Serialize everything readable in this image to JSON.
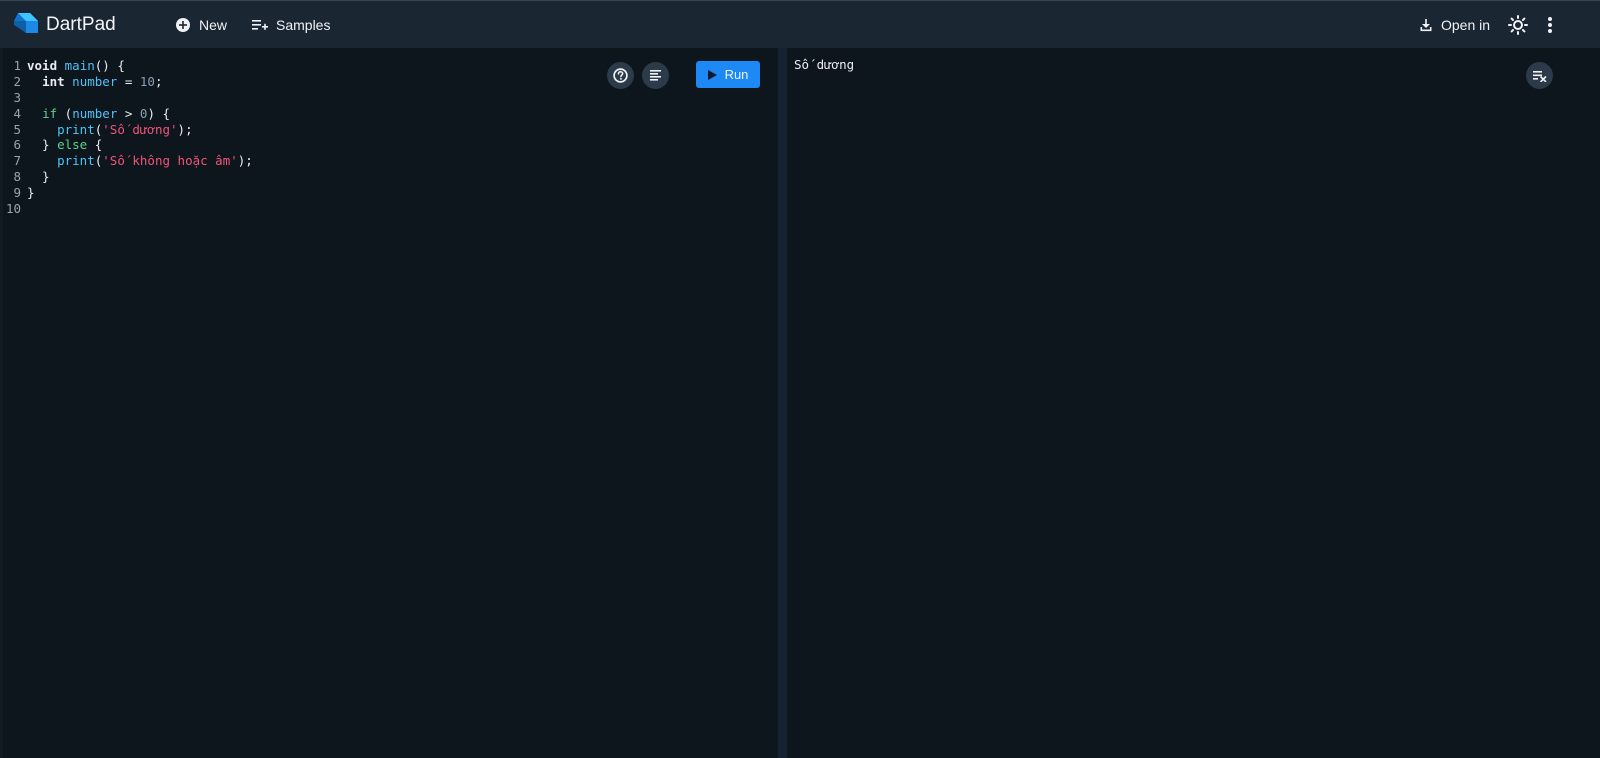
{
  "app": {
    "title": "DartPad"
  },
  "toolbar": {
    "new_label": "New",
    "samples_label": "Samples",
    "open_in_label": "Open in"
  },
  "editor": {
    "run_label": "Run",
    "lines": [
      {
        "n": "1",
        "tokens": [
          [
            "kw",
            "void"
          ],
          [
            "pun",
            " "
          ],
          [
            "fn",
            "main"
          ],
          [
            "pun",
            "() {"
          ]
        ]
      },
      {
        "n": "2",
        "tokens": [
          [
            "pun",
            "  "
          ],
          [
            "kw",
            "int"
          ],
          [
            "pun",
            " "
          ],
          [
            "var",
            "number"
          ],
          [
            "pun",
            " = "
          ],
          [
            "num",
            "10"
          ],
          [
            "pun",
            ";"
          ]
        ]
      },
      {
        "n": "3",
        "tokens": []
      },
      {
        "n": "4",
        "tokens": [
          [
            "pun",
            "  "
          ],
          [
            "ctl",
            "if"
          ],
          [
            "pun",
            " ("
          ],
          [
            "var",
            "number"
          ],
          [
            "pun",
            " > "
          ],
          [
            "num",
            "0"
          ],
          [
            "pun",
            ") {"
          ]
        ]
      },
      {
        "n": "5",
        "tokens": [
          [
            "pun",
            "    "
          ],
          [
            "fn",
            "print"
          ],
          [
            "pun",
            "("
          ],
          [
            "str",
            "'Số dương'"
          ],
          [
            "pun",
            ");"
          ]
        ]
      },
      {
        "n": "6",
        "tokens": [
          [
            "pun",
            "  } "
          ],
          [
            "ctl",
            "else"
          ],
          [
            "pun",
            " {"
          ]
        ]
      },
      {
        "n": "7",
        "tokens": [
          [
            "pun",
            "    "
          ],
          [
            "fn",
            "print"
          ],
          [
            "pun",
            "("
          ],
          [
            "str",
            "'Số không hoặc âm'"
          ],
          [
            "pun",
            ");"
          ]
        ]
      },
      {
        "n": "8",
        "tokens": [
          [
            "pun",
            "  }"
          ]
        ]
      },
      {
        "n": "9",
        "tokens": [
          [
            "pun",
            "}"
          ]
        ]
      },
      {
        "n": "10",
        "tokens": []
      }
    ]
  },
  "output": {
    "text": "Số dương"
  },
  "colors": {
    "accent": "#1e88f5",
    "topbar": "#1b2633",
    "background": "#0d151d",
    "string": "#f2547a",
    "function": "#4fc3f7",
    "control": "#62d08a"
  },
  "icons": {
    "logo": "dart-logo-icon",
    "new": "add-circle-icon",
    "samples": "playlist-add-icon",
    "open_in": "download-icon",
    "theme": "sun-icon",
    "more": "more-vert-icon",
    "help": "help-icon",
    "format": "format-align-icon",
    "run": "play-icon",
    "clear": "clear-output-icon"
  }
}
